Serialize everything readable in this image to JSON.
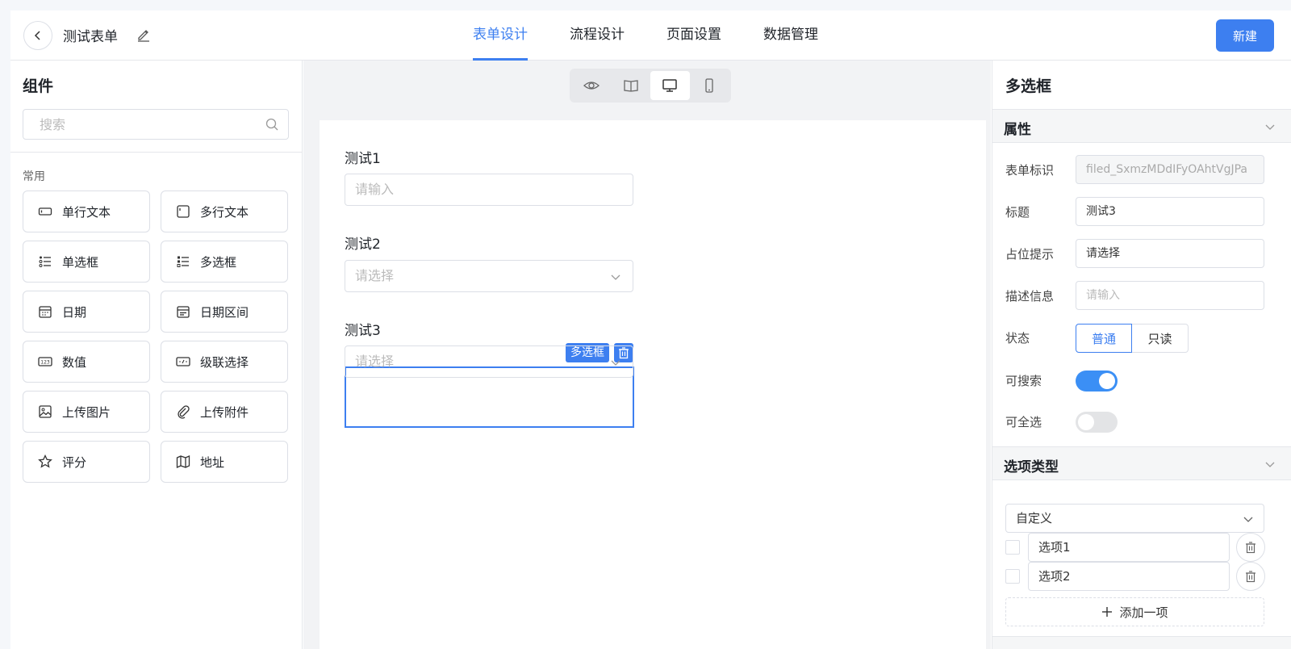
{
  "header": {
    "form_title": "测试表单",
    "tabs": [
      {
        "label": "表单设计",
        "active": true
      },
      {
        "label": "流程设计",
        "active": false
      },
      {
        "label": "页面设置",
        "active": false
      },
      {
        "label": "数据管理",
        "active": false
      }
    ],
    "new_label": "新建",
    "accent_color": "#3d7ff0"
  },
  "left": {
    "title": "组件",
    "search_placeholder": "搜索",
    "section": "常用",
    "components": [
      {
        "label": "单行文本",
        "icon": "single-line-text-icon"
      },
      {
        "label": "多行文本",
        "icon": "multi-line-text-icon"
      },
      {
        "label": "单选框",
        "icon": "radio-list-icon"
      },
      {
        "label": "多选框",
        "icon": "checkbox-list-icon"
      },
      {
        "label": "日期",
        "icon": "calendar-icon"
      },
      {
        "label": "日期区间",
        "icon": "date-range-icon"
      },
      {
        "label": "数值",
        "icon": "number-icon"
      },
      {
        "label": "级联选择",
        "icon": "cascader-icon"
      },
      {
        "label": "上传图片",
        "icon": "image-icon"
      },
      {
        "label": "上传附件",
        "icon": "paperclip-icon"
      },
      {
        "label": "评分",
        "icon": "star-icon"
      },
      {
        "label": "地址",
        "icon": "map-icon"
      }
    ]
  },
  "canvas": {
    "view_modes": [
      "preview-eye-icon",
      "book-icon",
      "desktop-icon",
      "mobile-icon"
    ],
    "active_view": "desktop-icon",
    "fields": [
      {
        "label": "测试1",
        "placeholder": "请输入",
        "type": "input"
      },
      {
        "label": "测试2",
        "placeholder": "请选择",
        "type": "select"
      },
      {
        "label": "测试3",
        "placeholder": "请选择",
        "type": "select",
        "selected": true
      }
    ],
    "selected_tag": "多选框"
  },
  "right": {
    "title": "多选框",
    "attr_section": "属性",
    "props": {
      "id_label": "表单标识",
      "id_value": "filed_SxmzMDdIFyOAhtVgJPa",
      "title_label": "标题",
      "title_value": "测试3",
      "placeholder_label": "占位提示",
      "placeholder_value": "请选择",
      "desc_label": "描述信息",
      "desc_placeholder": "请输入",
      "state_label": "状态",
      "state_normal": "普通",
      "state_readonly": "只读",
      "searchable_label": "可搜索",
      "searchable": true,
      "select_all_label": "可全选",
      "select_all": false
    },
    "option_section": "选项类型",
    "option_type": "自定义",
    "options": [
      "选项1",
      "选项2"
    ],
    "add_option_label": "添加一项"
  }
}
